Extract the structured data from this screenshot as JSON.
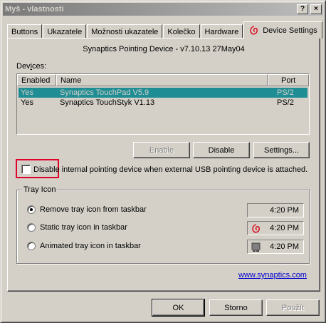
{
  "window": {
    "title": "Myš - vlastnosti",
    "help_glyph": "?",
    "close_glyph": "×"
  },
  "tabs": [
    {
      "label": "Buttons"
    },
    {
      "label": "Ukazatele"
    },
    {
      "label": "Možnosti ukazatele"
    },
    {
      "label": "Kolečko"
    },
    {
      "label": "Hardware"
    },
    {
      "label": "Device Settings"
    }
  ],
  "panel": {
    "header": "Synaptics Pointing Device - v7.10.13 27May04",
    "devices_label": "Devices:",
    "columns": {
      "enabled": "Enabled",
      "name": "Name",
      "port": "Port"
    },
    "devices": [
      {
        "enabled": "Yes",
        "name": "Synaptics TouchPad V5.9",
        "port": "PS/2"
      },
      {
        "enabled": "Yes",
        "name": "Synaptics TouchStyk V1.13",
        "port": "PS/2"
      }
    ],
    "buttons": {
      "enable": "Enable",
      "disable": "Disable",
      "settings": "Settings..."
    },
    "checkbox_label": "Disable internal pointing device when external USB pointing device is attached.",
    "tray": {
      "title": "Tray Icon",
      "options": [
        {
          "label": "Remove tray icon from taskbar",
          "time": "4:20 PM"
        },
        {
          "label": "Static tray icon in taskbar",
          "time": "4:20 PM"
        },
        {
          "label": "Animated tray icon in taskbar",
          "time": "4:20 PM"
        }
      ]
    },
    "link": "www.synaptics.com"
  },
  "footer": {
    "ok": "OK",
    "cancel": "Storno",
    "apply": "Použít"
  },
  "colors": {
    "selection": "#1e8d94",
    "highlight_box": "#e0002a",
    "link": "#0000cc"
  }
}
